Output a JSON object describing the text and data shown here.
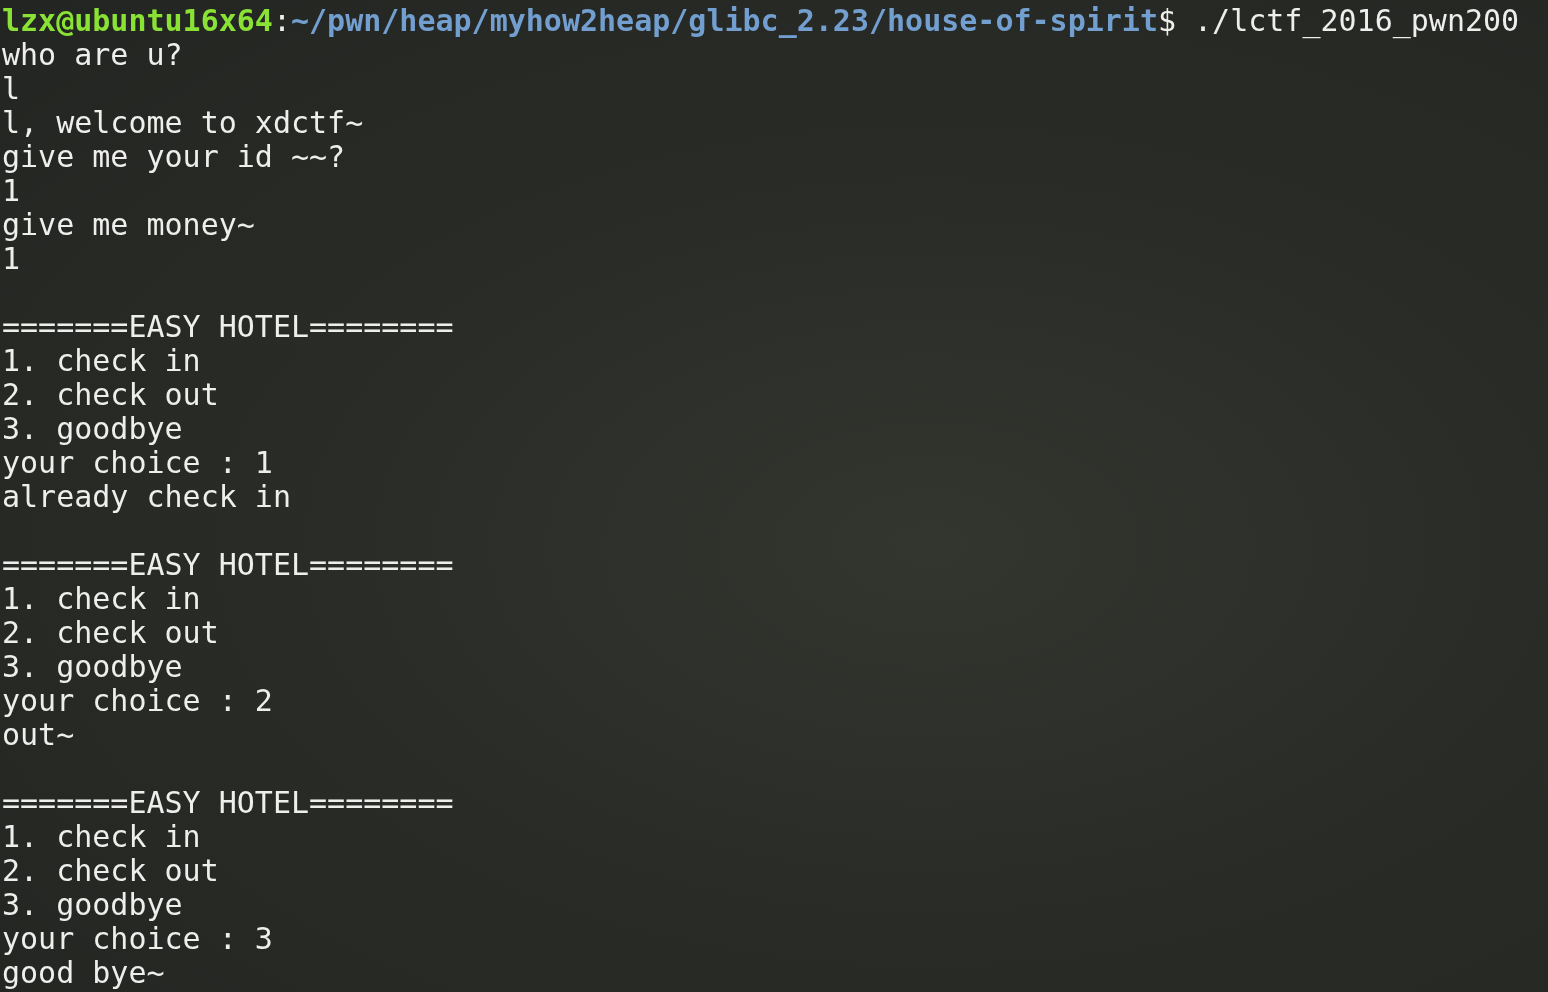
{
  "prompt": {
    "user_host": "lzx@ubuntu16x64",
    "separator": ":",
    "path": "~/pwn/heap/myhow2heap/glibc_2.23/house-of-spirit",
    "symbol": "$",
    "command": "./lctf_2016_pwn200"
  },
  "lines": [
    {
      "kind": "output",
      "text": "who are u?"
    },
    {
      "kind": "output",
      "text": "l"
    },
    {
      "kind": "output",
      "text": "l, welcome to xdctf~"
    },
    {
      "kind": "output",
      "text": "give me your id ~~?"
    },
    {
      "kind": "output",
      "text": "1"
    },
    {
      "kind": "output",
      "text": "give me money~"
    },
    {
      "kind": "output",
      "text": "1"
    },
    {
      "kind": "blank"
    },
    {
      "kind": "output",
      "text": "=======EASY HOTEL========"
    },
    {
      "kind": "output",
      "text": "1. check in"
    },
    {
      "kind": "output",
      "text": "2. check out"
    },
    {
      "kind": "output",
      "text": "3. goodbye"
    },
    {
      "kind": "output",
      "text": "your choice : 1"
    },
    {
      "kind": "output",
      "text": "already check in"
    },
    {
      "kind": "blank"
    },
    {
      "kind": "output",
      "text": "=======EASY HOTEL========"
    },
    {
      "kind": "output",
      "text": "1. check in"
    },
    {
      "kind": "output",
      "text": "2. check out"
    },
    {
      "kind": "output",
      "text": "3. goodbye"
    },
    {
      "kind": "output",
      "text": "your choice : 2"
    },
    {
      "kind": "output",
      "text": "out~"
    },
    {
      "kind": "blank"
    },
    {
      "kind": "output",
      "text": "=======EASY HOTEL========"
    },
    {
      "kind": "output",
      "text": "1. check in"
    },
    {
      "kind": "output",
      "text": "2. check out"
    },
    {
      "kind": "output",
      "text": "3. goodbye"
    },
    {
      "kind": "output",
      "text": "your choice : 3"
    },
    {
      "kind": "output",
      "text": "good bye~"
    }
  ]
}
